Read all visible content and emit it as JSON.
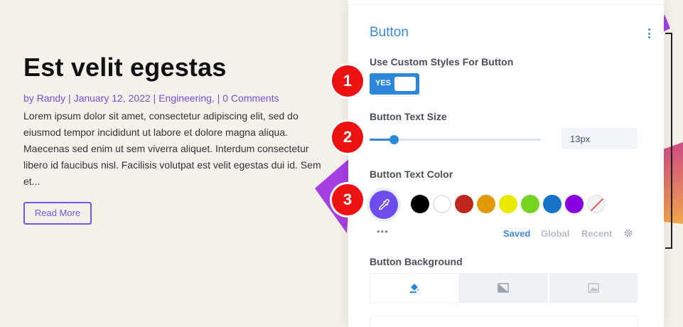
{
  "post": {
    "title": "Est velit egestas",
    "meta_prefix": "by ",
    "author": "Randy",
    "sep1": " | ",
    "date": "January 12, 2022",
    "sep2": " | ",
    "category": "Engineering,",
    "sep3": " | ",
    "comments": "0 Comments",
    "excerpt": "Lorem ipsum dolor sit amet, consectetur adipiscing elit, sed do eiusmod tempor incididunt ut labore et dolore magna aliqua. Maecenas sed enim ut sem viverra aliquet. Interdum consectetur libero id faucibus nisl. Facilisis volutpat est velit egestas dui id. Sem et...",
    "read_more": "Read More"
  },
  "panel": {
    "title": "Button",
    "custom_styles_label": "Use Custom Styles For Button",
    "toggle_value": "YES",
    "text_size_label": "Button Text Size",
    "text_size_value": "13px",
    "text_size_slider_fraction": 0.14,
    "text_color_label": "Button Text Color",
    "swatches": [
      "#000000",
      "#ffffff",
      "#c0281e",
      "#e09a06",
      "#eaea00",
      "#76d322",
      "#1673c7",
      "#8800e0",
      "none"
    ],
    "more_dots": "•••",
    "palette_tabs": [
      "Saved",
      "Global",
      "Recent"
    ],
    "background_label": "Button Background"
  },
  "markers": [
    "1",
    "2",
    "3"
  ],
  "colors": {
    "accent": "#2b87da",
    "eyedropper": "#6f4dea",
    "marker": "#ee1111",
    "link": "#7b4dd8"
  }
}
